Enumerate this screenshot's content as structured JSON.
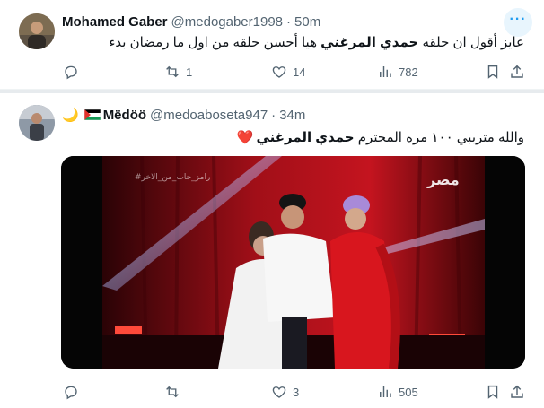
{
  "tweets": [
    {
      "display_name": "Mohamed Gaber",
      "handle": "@medogaber1998",
      "time": "50m",
      "text_pre": "عايز أقول ان حلقه ",
      "text_bold": "حمدي المرغني",
      "text_post": " هيا أحسن حلقه من اول ما رمضان بدء",
      "replies": "",
      "retweets": "1",
      "likes": "14",
      "views": "782"
    },
    {
      "display_name": "Mëdöö",
      "handle": "@medoaboseta947",
      "time": "34m",
      "text_pre": "والله مترببي ١٠٠ مره المحترم ",
      "text_bold": "حمدي المرغني",
      "text_post": "",
      "emoji": "❤️",
      "name_suffix_icons": [
        "palestine-flag",
        "crescent-moon"
      ],
      "replies": "",
      "retweets": "",
      "likes": "3",
      "views": "505",
      "video_watermark": "#رامز_جاب_من_الاخر",
      "channel_logo": "مصر"
    }
  ],
  "ui": {
    "more_glyph": "···",
    "moon_glyph": "🌙",
    "dot": "·"
  },
  "colors": {
    "accent": "#1d9bf0",
    "secondary_text": "#536471",
    "heart": "#e0245e",
    "stage_red": "#b3121e"
  }
}
